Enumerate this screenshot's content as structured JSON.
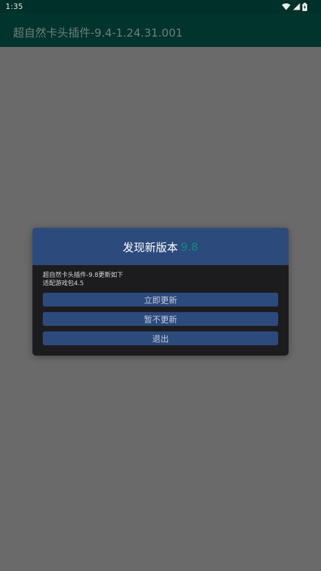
{
  "status_bar": {
    "time": "1:35",
    "icons": [
      "wifi-icon",
      "cell-signal-icon",
      "battery-charging-icon"
    ]
  },
  "app_bar": {
    "title": "超自然卡头插件-9.4-1.24.31.001"
  },
  "dialog": {
    "title": "发现新版本",
    "version": "9.8",
    "message_lines": [
      "超自然卡头插件-9.8更新如下",
      "适配游戏包4.5"
    ],
    "buttons": {
      "update_now": "立即更新",
      "not_now": "暂不更新",
      "exit": "退出"
    }
  },
  "colors": {
    "status_bar_bg": "#00302a",
    "app_bar_bg": "#02342e",
    "scrim": "#6a6a6a",
    "dialog_bg": "#1c1c1e",
    "dialog_accent": "#2c4a7c",
    "version_color": "#0f8c7a"
  }
}
